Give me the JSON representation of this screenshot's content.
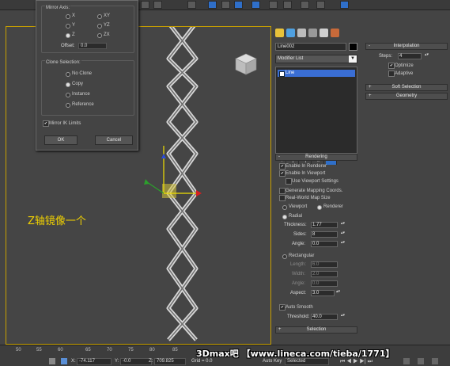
{
  "mirror_dialog": {
    "mirror_axis_title": "Mirror Axis:",
    "axes": [
      "X",
      "Y",
      "Z",
      "XY",
      "YZ",
      "ZX"
    ],
    "selected_axis": "Z",
    "offset_label": "Offset:",
    "offset_value": "0.0",
    "clone_selection_title": "Clone Selection:",
    "clone_options": [
      "No Clone",
      "Copy",
      "Instance",
      "Reference"
    ],
    "selected_clone": "Copy",
    "mirror_ik_label": "Mirror IK Limits",
    "mirror_ik_checked": true,
    "ok_label": "OK",
    "cancel_label": "Cancel"
  },
  "viewport": {
    "annotation": "Z轴镜像一个",
    "annotation_color": "#f2d200",
    "border_color": "#c8a000"
  },
  "command_panel": {
    "object_name": "Line002",
    "modifier_list_label": "Modifier List",
    "stack_item": "Line",
    "selection_color": "#3a6ed4"
  },
  "interpolation": {
    "title": "Interpolation",
    "steps_label": "Steps:",
    "steps_value": "4",
    "optimize_label": "Optimize",
    "optimize_checked": true,
    "adaptive_label": "Adaptive",
    "adaptive_checked": false,
    "soft_selection_label": "Soft Selection",
    "geometry_label": "Geometry"
  },
  "rendering": {
    "title": "Rendering",
    "enable_renderer": "Enable In Renderer",
    "enable_viewport": "Enable In Viewport",
    "use_viewport_settings": "Use Viewport Settings",
    "gen_mapping": "Generate Mapping Coords.",
    "real_world_map": "Real-World Map Size",
    "viewport_radio": "Viewport",
    "renderer_radio": "Renderer",
    "radial_label": "Radial",
    "thickness_label": "Thickness:",
    "thickness_value": "1.77",
    "sides_label": "Sides:",
    "sides_value": "8",
    "angle_label": "Angle:",
    "angle_value": "0.0",
    "rectangular_label": "Rectangular",
    "length_label": "Length:",
    "length_value": "6.0",
    "width_label": "Width:",
    "width_value": "2.0",
    "rect_angle_label": "Angle:",
    "rect_angle_value": "0.0",
    "aspect_label": "Aspect:",
    "aspect_value": "3.0",
    "auto_smooth_label": "Auto Smooth",
    "threshold_label": "Threshold:",
    "threshold_value": "40.0",
    "selection_label": "Selection"
  },
  "status": {
    "ticks": [
      "50",
      "55",
      "60",
      "65",
      "70",
      "75",
      "80",
      "85"
    ],
    "x_label": "X:",
    "x_value": "-74.117",
    "y_label": "Y:",
    "y_value": "-0.0",
    "z_label": "Z:",
    "z_value": "709.825",
    "grid_label": "Grid = 0.0",
    "auto_key": "Auto Key",
    "selected_label": "Selected",
    "watermark": "3Dmax吧 【www.lineca.com/tieba/1771】"
  }
}
